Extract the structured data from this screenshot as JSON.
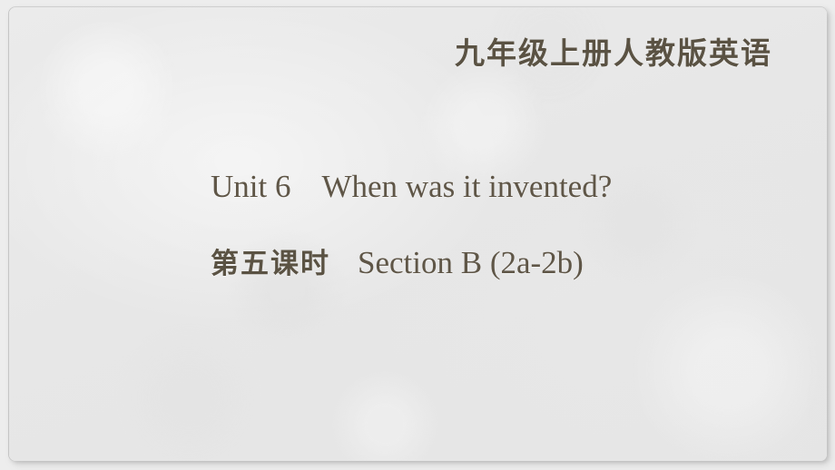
{
  "slide": {
    "header": {
      "course_banner": "九年级上册人教版英语"
    },
    "title": {
      "unit_line": "Unit 6　When was it invented?",
      "unit_label": "Unit 6",
      "unit_topic": "When was it invented?"
    },
    "subtitle": {
      "period_cn": "第五课时",
      "section_en": "Section B (2a-2b)"
    },
    "colors": {
      "background": "#ededed",
      "panel": "#e8e8e8",
      "text_serif": "#5f5647",
      "text_brush": "#5a5243"
    }
  }
}
